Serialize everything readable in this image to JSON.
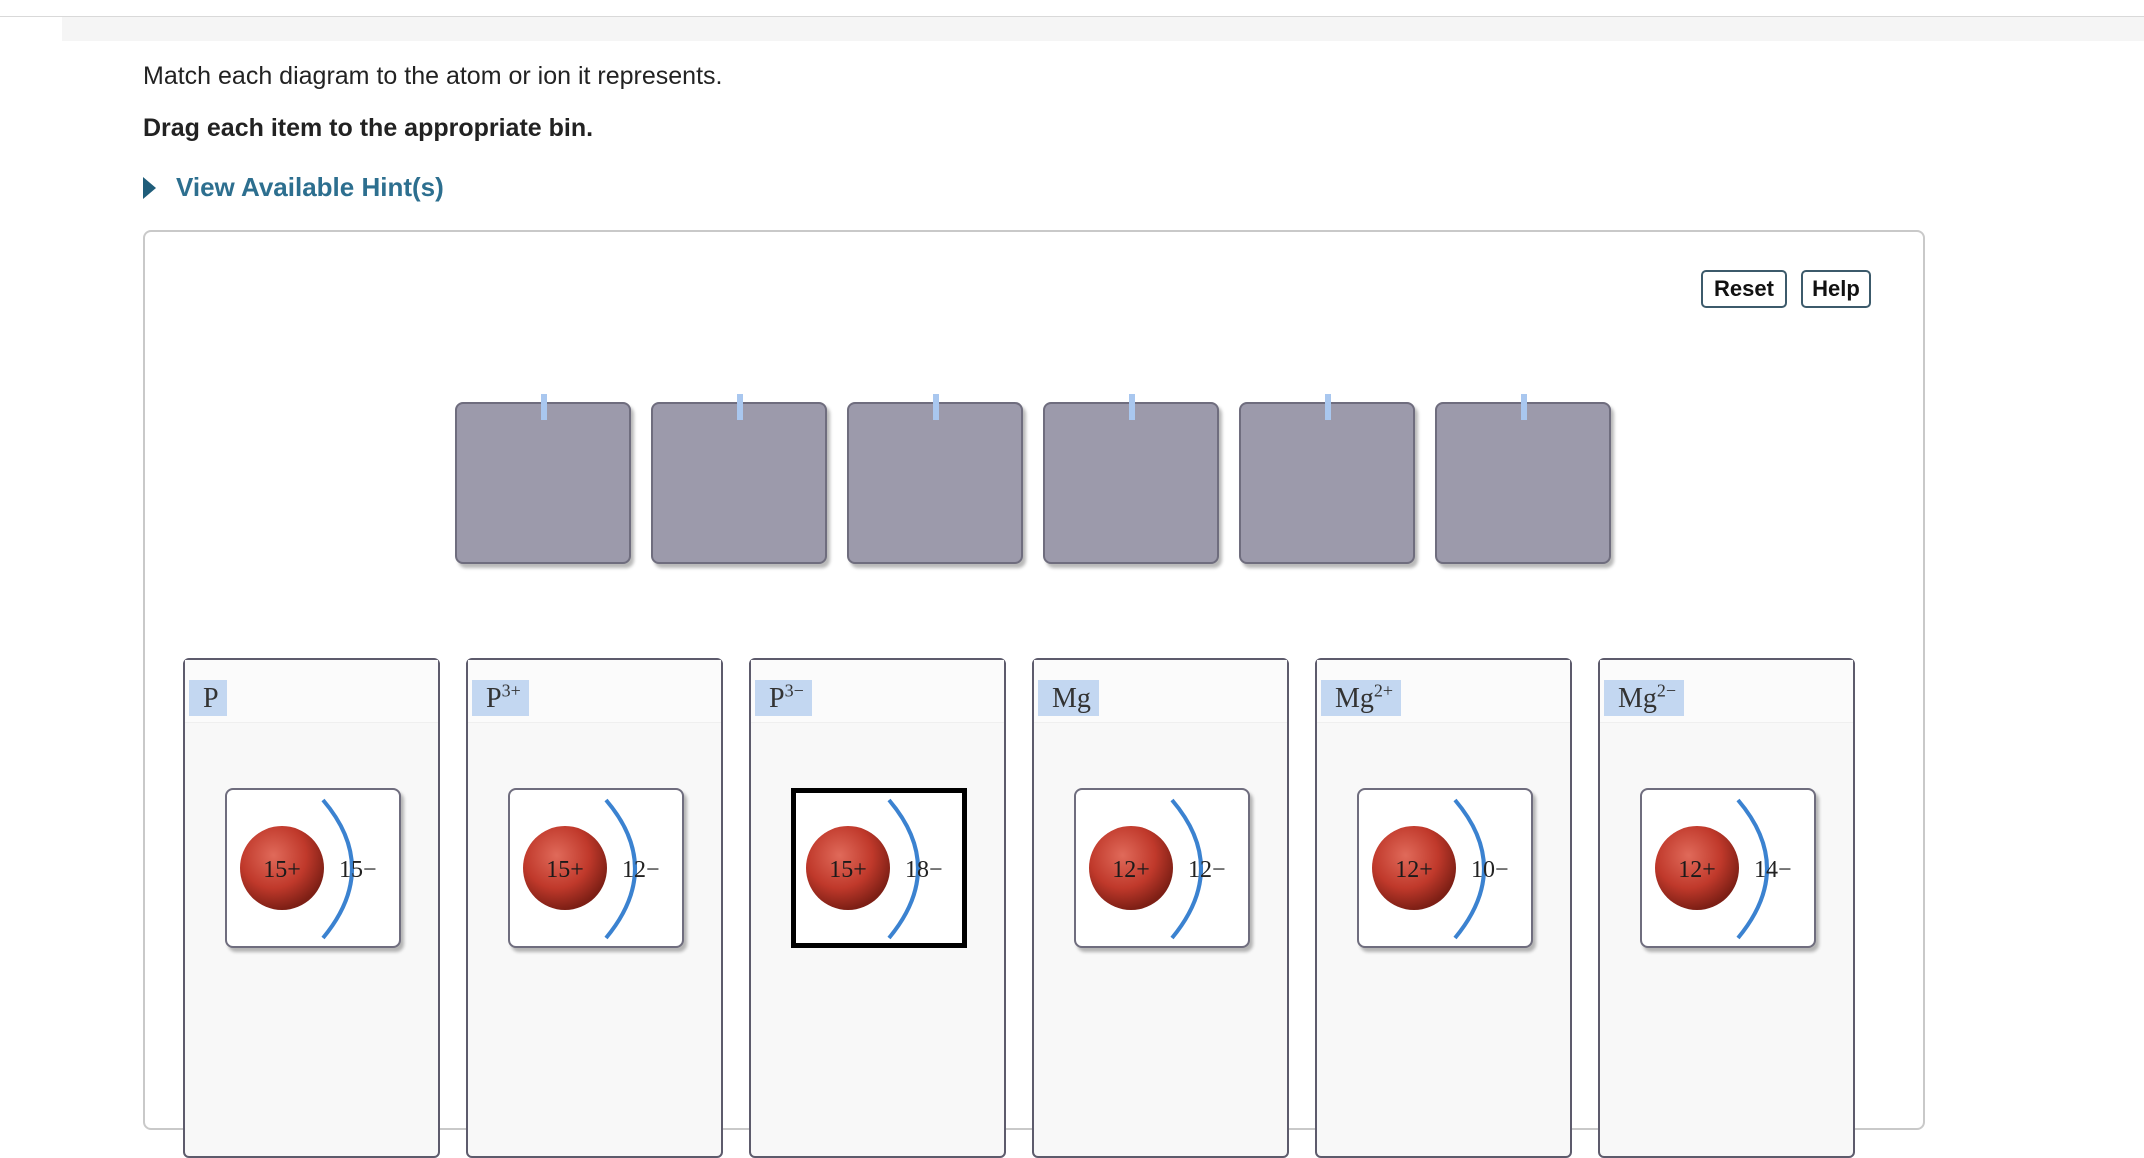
{
  "instructions": {
    "line1": "Match each diagram to the atom or ion it represents.",
    "line2": "Drag each item to the appropriate bin."
  },
  "hint": {
    "label": "View Available Hint(s)"
  },
  "toolbar": {
    "reset_label": "Reset",
    "help_label": "Help"
  },
  "targets": [
    {
      "label": ""
    },
    {
      "label": ""
    },
    {
      "label": ""
    },
    {
      "label": ""
    },
    {
      "label": ""
    },
    {
      "label": ""
    }
  ],
  "bins": [
    {
      "symbol": "P",
      "charge": "",
      "nucleus": "15+",
      "electrons": "15−",
      "selected": false
    },
    {
      "symbol": "P",
      "charge": "3+",
      "nucleus": "15+",
      "electrons": "12−",
      "selected": false
    },
    {
      "symbol": "P",
      "charge": "3−",
      "nucleus": "15+",
      "electrons": "18−",
      "selected": true
    },
    {
      "symbol": "Mg",
      "charge": "",
      "nucleus": "12+",
      "electrons": "12−",
      "selected": false
    },
    {
      "symbol": "Mg",
      "charge": "2+",
      "nucleus": "12+",
      "electrons": "10−",
      "selected": false
    },
    {
      "symbol": "Mg",
      "charge": "2−",
      "nucleus": "12+",
      "electrons": "14−",
      "selected": false
    }
  ],
  "colors": {
    "nucleus": "#c0392b",
    "shell": "#3b82d0",
    "hint_link": "#2d6f8f",
    "slot_fill": "#9c9aab",
    "label_highlight": "#c3d7f1"
  }
}
